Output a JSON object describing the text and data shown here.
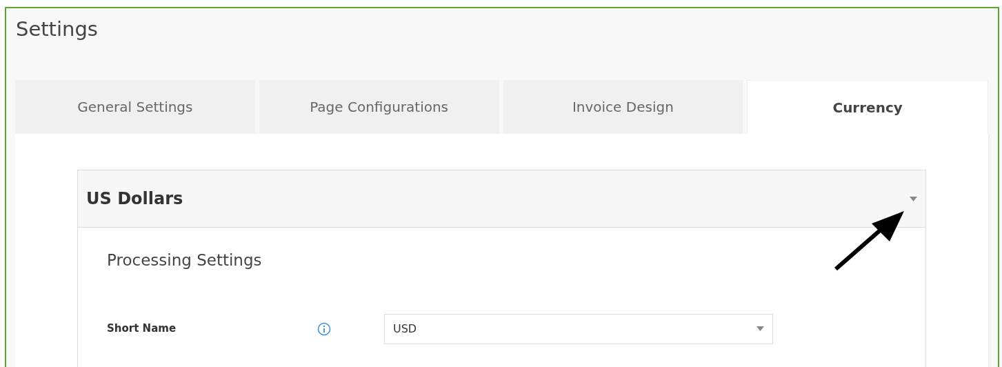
{
  "page": {
    "title": "Settings"
  },
  "tabs": [
    {
      "label": "General Settings",
      "selected": false
    },
    {
      "label": "Page Configurations",
      "selected": false
    },
    {
      "label": "Invoice Design",
      "selected": false
    },
    {
      "label": "Currency",
      "selected": true
    }
  ],
  "accordion": {
    "title": "US Dollars",
    "expanded": true,
    "section_title": "Processing Settings",
    "fields": [
      {
        "label": "Short Name",
        "value": "USD"
      }
    ]
  }
}
